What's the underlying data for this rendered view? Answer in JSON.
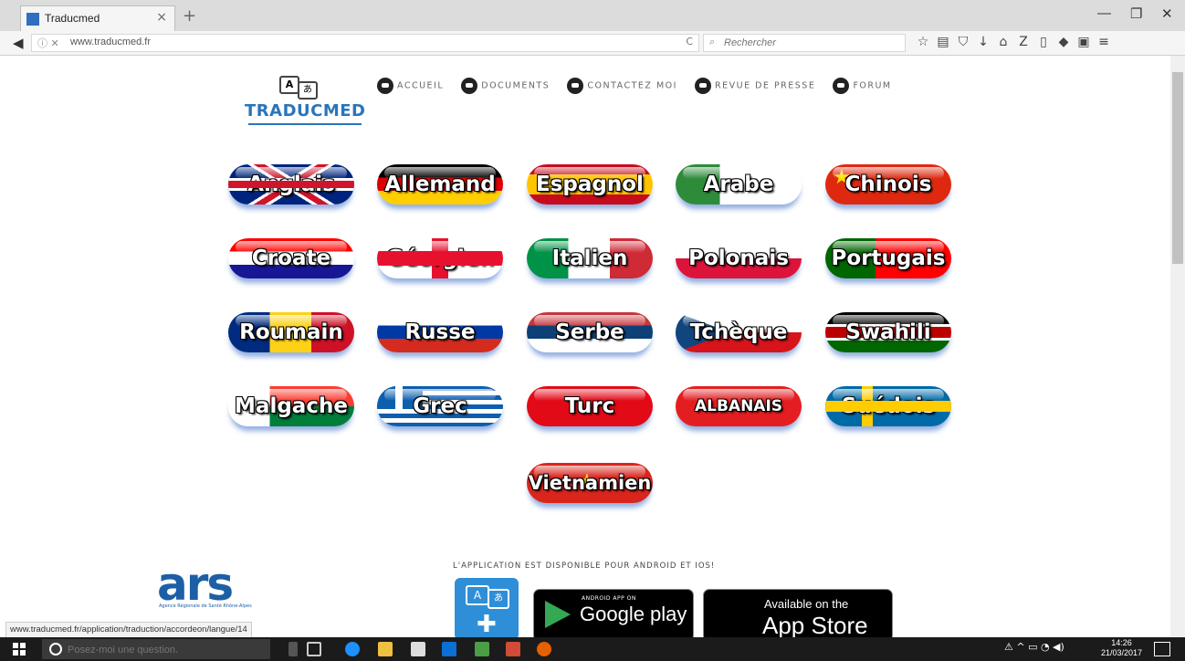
{
  "browser": {
    "tab_title": "Traducmed",
    "tab_close": "×",
    "new_tab": "+",
    "url": "www.traducmed.fr",
    "reload_glyph": "C",
    "search_placeholder": "Rechercher",
    "status_url": "www.traducmed.fr/application/traduction/accordeon/langue/14"
  },
  "logo": {
    "text": "TRADUCMED",
    "glyph_a": "A",
    "glyph_b": "あ"
  },
  "nav": {
    "items": [
      {
        "label": "ACCUEIL",
        "icon": "home-icon"
      },
      {
        "label": "DOCUMENTS",
        "icon": "documents-icon"
      },
      {
        "label": "CONTACTEZ MOI",
        "icon": "mail-icon"
      },
      {
        "label": "REVUE DE PRESSE",
        "icon": "press-icon"
      },
      {
        "label": "FORUM",
        "icon": "forum-icon"
      }
    ]
  },
  "languages": [
    {
      "label": "Anglais",
      "flag": "uk"
    },
    {
      "label": "Allemand",
      "flag": "de"
    },
    {
      "label": "Espagnol",
      "flag": "es"
    },
    {
      "label": "Arabe",
      "flag": "ar"
    },
    {
      "label": "Chinois",
      "flag": "cn"
    },
    {
      "label": "Croate",
      "flag": "hr"
    },
    {
      "label": "Géorgien",
      "flag": "ge"
    },
    {
      "label": "Italien",
      "flag": "it"
    },
    {
      "label": "Polonais",
      "flag": "pl"
    },
    {
      "label": "Portugais",
      "flag": "pt"
    },
    {
      "label": "Roumain",
      "flag": "ro"
    },
    {
      "label": "Russe",
      "flag": "ru"
    },
    {
      "label": "Serbe",
      "flag": "rs"
    },
    {
      "label": "Tchèque",
      "flag": "cz"
    },
    {
      "label": "Swahili",
      "flag": "sw"
    },
    {
      "label": "Malgache",
      "flag": "mg"
    },
    {
      "label": "Grec",
      "flag": "gr"
    },
    {
      "label": "Turc",
      "flag": "tr"
    },
    {
      "label": "ALBANAIS",
      "flag": "al"
    },
    {
      "label": "Suédois",
      "flag": "se"
    },
    {
      "label": "Vietnamien",
      "flag": "vn"
    }
  ],
  "footer": {
    "app_note": "L'APPLICATION EST DISPONIBLE POUR ANDROID ET IOS!",
    "ars_logo": "ars",
    "ars_sub": "Agence Régionale de Santé Rhône-Alpes",
    "google_small": "ANDROID APP ON",
    "google_big": "Google play",
    "apple_small": "Available on the",
    "apple_big": "App Store"
  },
  "taskbar": {
    "search_placeholder": "Posez-moi une question.",
    "time": "14:26",
    "date": "21/03/2017"
  },
  "colors": {
    "brand_blue": "#2a75bb",
    "ars_green": "#7cbf2e",
    "pill_shadow": "#3a6ec8"
  }
}
